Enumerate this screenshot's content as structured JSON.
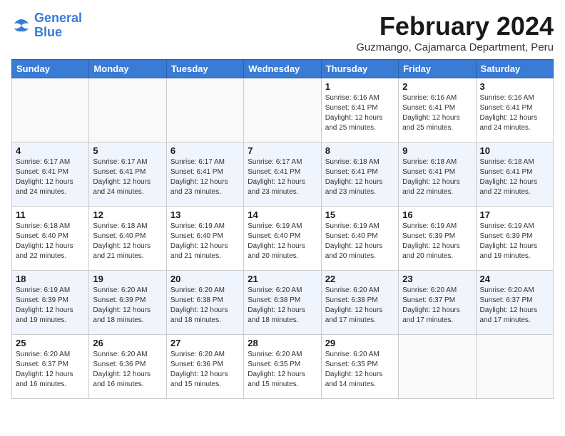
{
  "header": {
    "logo_line1": "General",
    "logo_line2": "Blue",
    "title": "February 2024",
    "subtitle": "Guzmango, Cajamarca Department, Peru"
  },
  "days_of_week": [
    "Sunday",
    "Monday",
    "Tuesday",
    "Wednesday",
    "Thursday",
    "Friday",
    "Saturday"
  ],
  "weeks": [
    [
      {
        "day": "",
        "info": ""
      },
      {
        "day": "",
        "info": ""
      },
      {
        "day": "",
        "info": ""
      },
      {
        "day": "",
        "info": ""
      },
      {
        "day": "1",
        "info": "Sunrise: 6:16 AM\nSunset: 6:41 PM\nDaylight: 12 hours\nand 25 minutes."
      },
      {
        "day": "2",
        "info": "Sunrise: 6:16 AM\nSunset: 6:41 PM\nDaylight: 12 hours\nand 25 minutes."
      },
      {
        "day": "3",
        "info": "Sunrise: 6:16 AM\nSunset: 6:41 PM\nDaylight: 12 hours\nand 24 minutes."
      }
    ],
    [
      {
        "day": "4",
        "info": "Sunrise: 6:17 AM\nSunset: 6:41 PM\nDaylight: 12 hours\nand 24 minutes."
      },
      {
        "day": "5",
        "info": "Sunrise: 6:17 AM\nSunset: 6:41 PM\nDaylight: 12 hours\nand 24 minutes."
      },
      {
        "day": "6",
        "info": "Sunrise: 6:17 AM\nSunset: 6:41 PM\nDaylight: 12 hours\nand 23 minutes."
      },
      {
        "day": "7",
        "info": "Sunrise: 6:17 AM\nSunset: 6:41 PM\nDaylight: 12 hours\nand 23 minutes."
      },
      {
        "day": "8",
        "info": "Sunrise: 6:18 AM\nSunset: 6:41 PM\nDaylight: 12 hours\nand 23 minutes."
      },
      {
        "day": "9",
        "info": "Sunrise: 6:18 AM\nSunset: 6:41 PM\nDaylight: 12 hours\nand 22 minutes."
      },
      {
        "day": "10",
        "info": "Sunrise: 6:18 AM\nSunset: 6:41 PM\nDaylight: 12 hours\nand 22 minutes."
      }
    ],
    [
      {
        "day": "11",
        "info": "Sunrise: 6:18 AM\nSunset: 6:40 PM\nDaylight: 12 hours\nand 22 minutes."
      },
      {
        "day": "12",
        "info": "Sunrise: 6:18 AM\nSunset: 6:40 PM\nDaylight: 12 hours\nand 21 minutes."
      },
      {
        "day": "13",
        "info": "Sunrise: 6:19 AM\nSunset: 6:40 PM\nDaylight: 12 hours\nand 21 minutes."
      },
      {
        "day": "14",
        "info": "Sunrise: 6:19 AM\nSunset: 6:40 PM\nDaylight: 12 hours\nand 20 minutes."
      },
      {
        "day": "15",
        "info": "Sunrise: 6:19 AM\nSunset: 6:40 PM\nDaylight: 12 hours\nand 20 minutes."
      },
      {
        "day": "16",
        "info": "Sunrise: 6:19 AM\nSunset: 6:39 PM\nDaylight: 12 hours\nand 20 minutes."
      },
      {
        "day": "17",
        "info": "Sunrise: 6:19 AM\nSunset: 6:39 PM\nDaylight: 12 hours\nand 19 minutes."
      }
    ],
    [
      {
        "day": "18",
        "info": "Sunrise: 6:19 AM\nSunset: 6:39 PM\nDaylight: 12 hours\nand 19 minutes."
      },
      {
        "day": "19",
        "info": "Sunrise: 6:20 AM\nSunset: 6:39 PM\nDaylight: 12 hours\nand 18 minutes."
      },
      {
        "day": "20",
        "info": "Sunrise: 6:20 AM\nSunset: 6:38 PM\nDaylight: 12 hours\nand 18 minutes."
      },
      {
        "day": "21",
        "info": "Sunrise: 6:20 AM\nSunset: 6:38 PM\nDaylight: 12 hours\nand 18 minutes."
      },
      {
        "day": "22",
        "info": "Sunrise: 6:20 AM\nSunset: 6:38 PM\nDaylight: 12 hours\nand 17 minutes."
      },
      {
        "day": "23",
        "info": "Sunrise: 6:20 AM\nSunset: 6:37 PM\nDaylight: 12 hours\nand 17 minutes."
      },
      {
        "day": "24",
        "info": "Sunrise: 6:20 AM\nSunset: 6:37 PM\nDaylight: 12 hours\nand 17 minutes."
      }
    ],
    [
      {
        "day": "25",
        "info": "Sunrise: 6:20 AM\nSunset: 6:37 PM\nDaylight: 12 hours\nand 16 minutes."
      },
      {
        "day": "26",
        "info": "Sunrise: 6:20 AM\nSunset: 6:36 PM\nDaylight: 12 hours\nand 16 minutes."
      },
      {
        "day": "27",
        "info": "Sunrise: 6:20 AM\nSunset: 6:36 PM\nDaylight: 12 hours\nand 15 minutes."
      },
      {
        "day": "28",
        "info": "Sunrise: 6:20 AM\nSunset: 6:35 PM\nDaylight: 12 hours\nand 15 minutes."
      },
      {
        "day": "29",
        "info": "Sunrise: 6:20 AM\nSunset: 6:35 PM\nDaylight: 12 hours\nand 14 minutes."
      },
      {
        "day": "",
        "info": ""
      },
      {
        "day": "",
        "info": ""
      }
    ]
  ]
}
